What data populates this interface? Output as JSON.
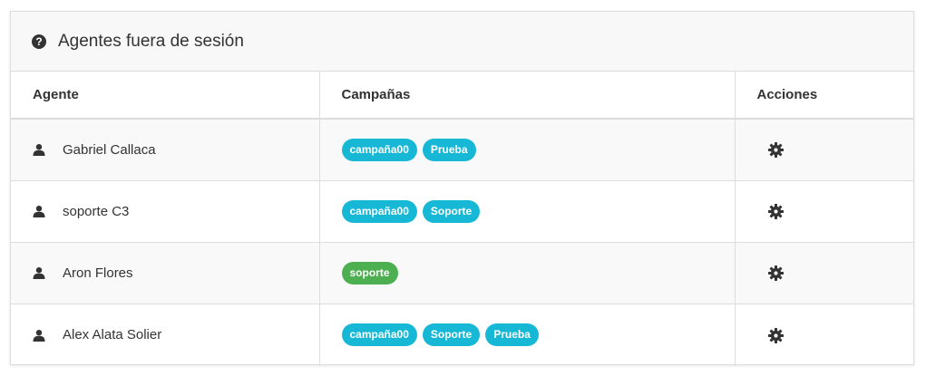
{
  "panel": {
    "title": "Agentes fuera de sesión",
    "help_icon": "question-circle-icon"
  },
  "table": {
    "headers": [
      "Agente",
      "Campañas",
      "Acciones"
    ],
    "rows": [
      {
        "agent": "Gabriel Callaca",
        "campaigns": [
          {
            "label": "campaña00",
            "color": "#17b8d6"
          },
          {
            "label": "Prueba",
            "color": "#17b8d6"
          }
        ]
      },
      {
        "agent": "soporte C3",
        "campaigns": [
          {
            "label": "campaña00",
            "color": "#17b8d6"
          },
          {
            "label": "Soporte",
            "color": "#17b8d6"
          }
        ]
      },
      {
        "agent": "Aron Flores",
        "campaigns": [
          {
            "label": "soporte",
            "color": "#4caf50"
          }
        ]
      },
      {
        "agent": "Alex Alata Solier",
        "campaigns": [
          {
            "label": "campaña00",
            "color": "#17b8d6"
          },
          {
            "label": "Soporte",
            "color": "#17b8d6"
          },
          {
            "label": "Prueba",
            "color": "#17b8d6"
          }
        ]
      }
    ],
    "row_icon": "user-icon",
    "action_icon": "gear-icon"
  },
  "colors": {
    "info_badge": "#17b8d6",
    "success_badge": "#4caf50"
  }
}
